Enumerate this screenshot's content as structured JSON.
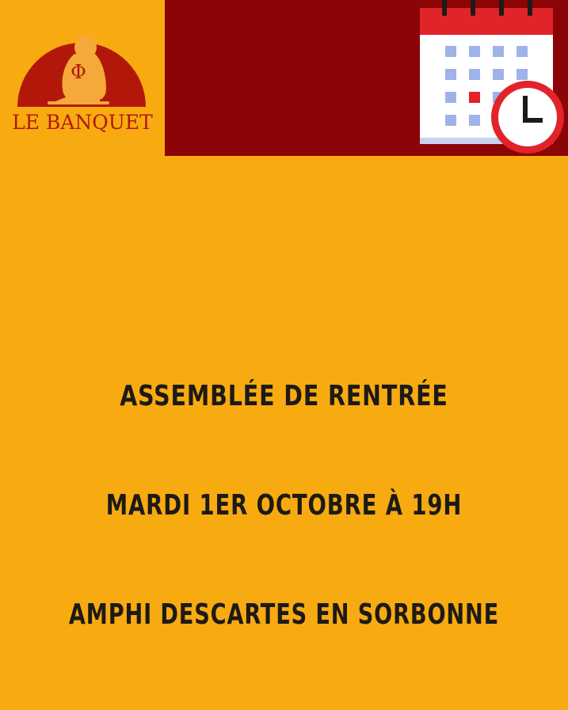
{
  "brand": {
    "name": "LE BANQUET",
    "symbol": "Φ"
  },
  "icons": {
    "logo": "owl-logo-icon",
    "calendar": "calendar-clock-icon"
  },
  "announcement": {
    "line1": "ASSEMBLÉE DE RENTRÉE",
    "line2": "MARDI 1ER OCTOBRE À 19H",
    "line3": "AMPHI DESCARTES EN SORBONNE"
  },
  "colors": {
    "background": "#F8AB10",
    "band": "#8B0406",
    "logo_red": "#B2180A",
    "text": "#1d1a17"
  }
}
